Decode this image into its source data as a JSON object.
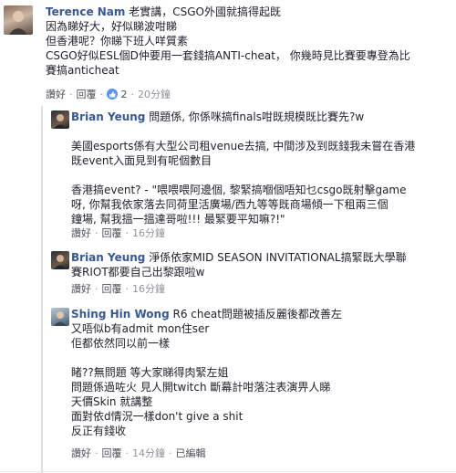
{
  "comments": [
    {
      "author": "Terence Nam",
      "lines": [
        "老實講，CSGO外國就搞得起既",
        "因為睇好大，好似睇波咁睇",
        "但香港呢？你睇下班人咩質素",
        "CSGO好似ESL個D仲要用一套錢搞ANTI-cheat， 你幾時見比賽要專登為比",
        "賽搞anticheat"
      ],
      "like_label": "讚好",
      "reply_label": "回覆",
      "reaction_count": "2",
      "time": "20分鐘"
    }
  ],
  "replies": [
    {
      "author": "Brian Yeung",
      "lines": [
        "問題係, 你係咪搞finals咁既規模既比賽先?w",
        "",
        "美國esports係有大型公司租venue去搞, 中間涉及到既錢我未嘗在香港",
        "既event入面見到有呢個數目",
        "",
        "香港搞event? - \"喂喂喂阿邊個, 黎緊搞嗰個唔知乜csgo既射擊game",
        "呀, 你幫我依家落去同荷里活廣場/西九等等既商場傾一下租兩三個",
        "鐘場, 幫我搵一搵達哥啦!!! 最緊要平知嘛?!\""
      ],
      "like_label": "讚好",
      "reply_label": "回覆",
      "time": "16分鐘"
    },
    {
      "author": "Brian Yeung",
      "lines": [
        "淨係依家MID SEASON INVITATIONAL搞緊既大學聯",
        "賽RIOT都要自己出黎跟啦w"
      ],
      "like_label": "讚好",
      "reply_label": "回覆",
      "time": "16分鐘"
    },
    {
      "author": "Shing Hin Wong",
      "lines": [
        "R6 cheat問題被插反麗後都改善左",
        "又唔似b有admit mon住ser",
        "佢都依然同以前一樣",
        "",
        "睹??無問題 等大家睇得肉緊左姐",
        "問題係過咗火 見人開twitch 斷幕計咁落注表演畀人睇",
        "天價Skin 就講整",
        "面對依d情況一樣don't give a shit",
        "反正有錢收"
      ],
      "like_label": "讚好",
      "reply_label": "回覆",
      "time": "14分鐘",
      "edited_label": "已編輯"
    }
  ],
  "colors": {
    "author": "#365899",
    "text": "#1d2129",
    "meta": "#90949c",
    "like_bubble": "#5890ff"
  }
}
